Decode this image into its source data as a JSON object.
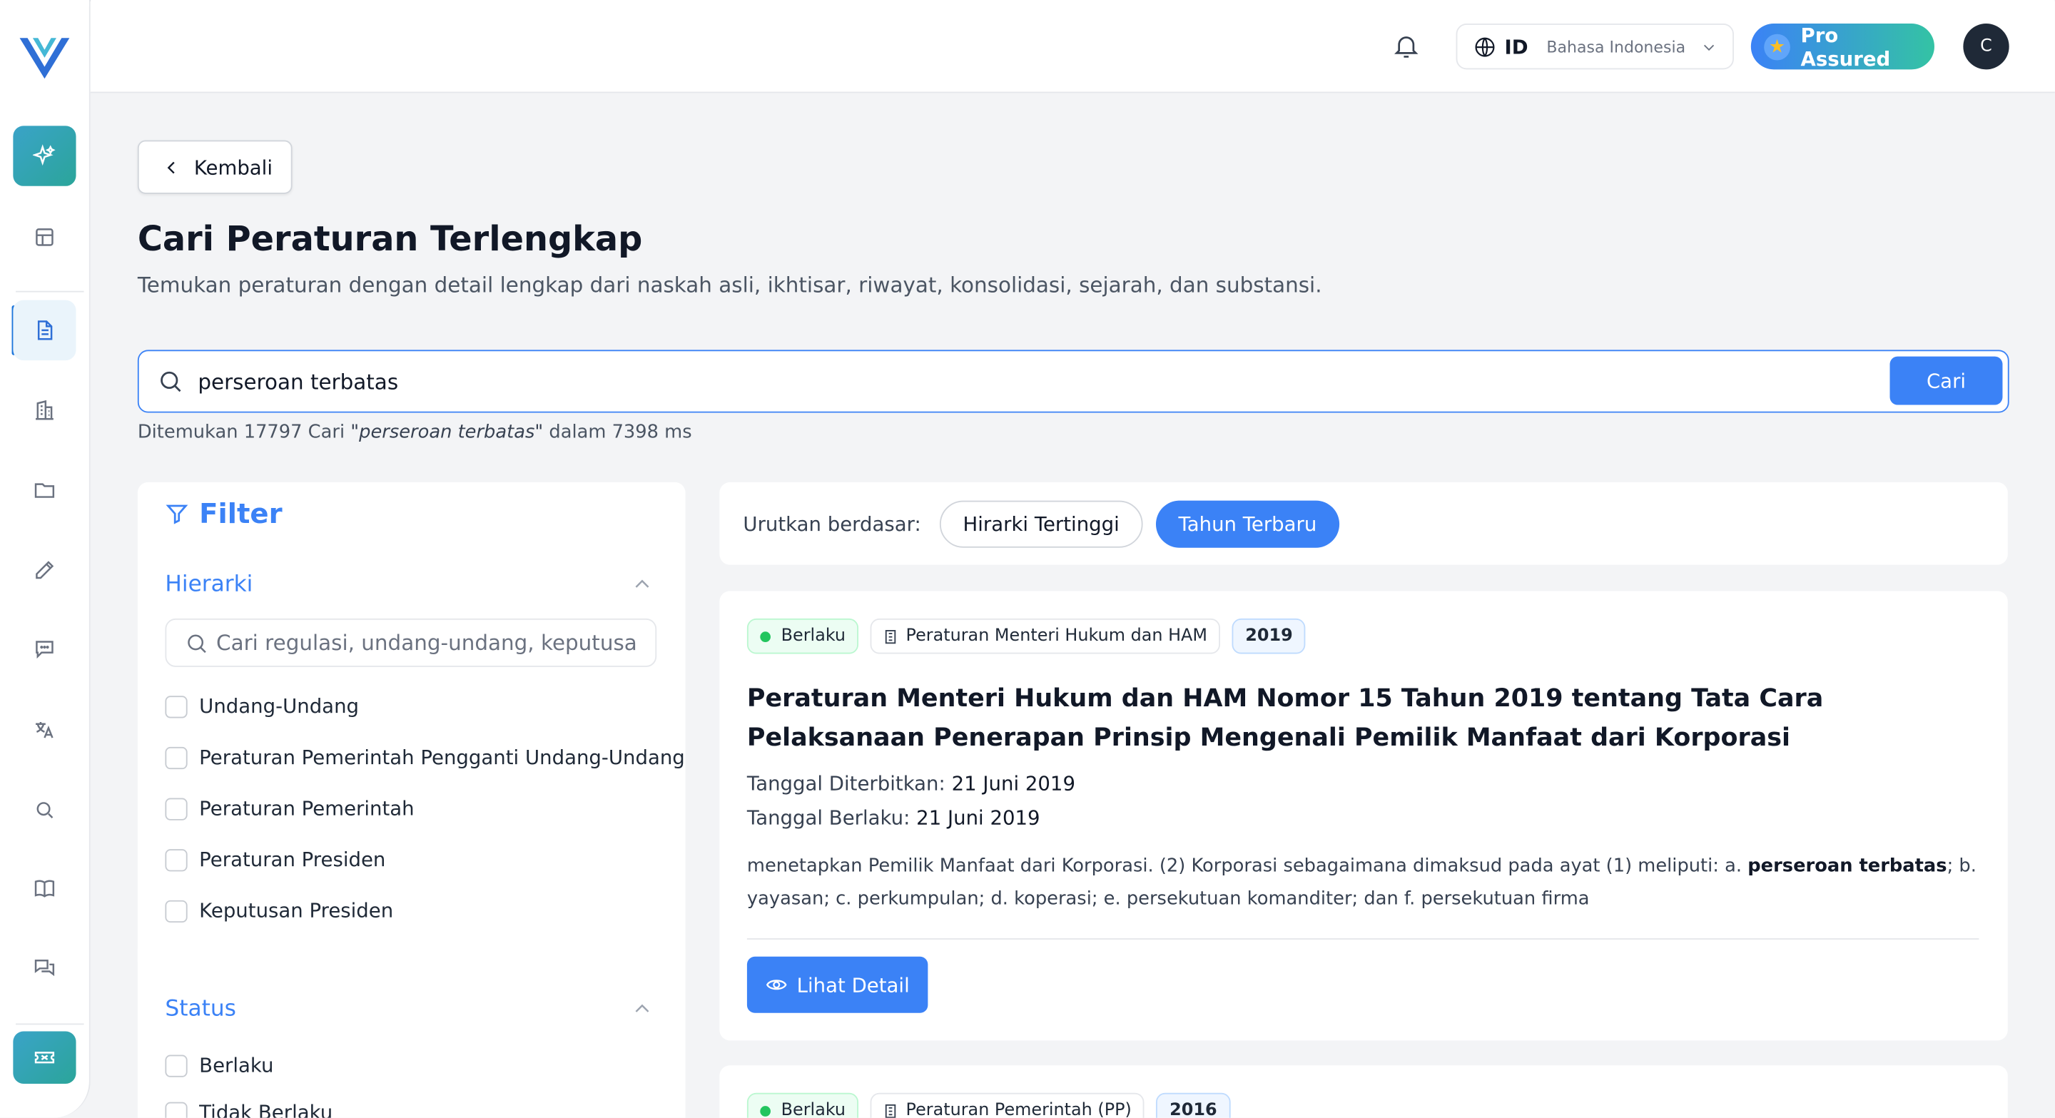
{
  "header": {
    "language_code": "ID",
    "language_name": "Bahasa Indonesia",
    "pro_label": "Pro Assured",
    "avatar_initial": "C"
  },
  "page": {
    "back_label": "Kembali",
    "title": "Cari Peraturan Terlengkap",
    "subtitle": "Temukan peraturan dengan detail lengkap dari naskah asli, ikhtisar, riwayat, konsolidasi, sejarah, dan substansi."
  },
  "search": {
    "value": "perseroan terbatas",
    "button": "Cari",
    "result_prefix": "Ditemukan 17797 Cari ",
    "result_query": "\"perseroan terbatas\"",
    "result_suffix": " dalam 7398 ms"
  },
  "filter": {
    "title": "Filter",
    "hierarchy_label": "Hierarki",
    "hierarchy_placeholder": "Cari regulasi, undang-undang, keputusan",
    "hierarchy_options": [
      "Undang-Undang",
      "Peraturan Pemerintah Pengganti Undang-Undang",
      "Peraturan Pemerintah",
      "Peraturan Presiden",
      "Keputusan Presiden"
    ],
    "status_label": "Status",
    "status_options": [
      "Berlaku",
      "Tidak Berlaku"
    ]
  },
  "sort": {
    "label": "Urutkan berdasar:",
    "options": [
      "Hirarki Tertinggi",
      "Tahun Terbaru"
    ],
    "selected": "Tahun Terbaru"
  },
  "results": [
    {
      "status": "Berlaku",
      "type": "Peraturan Menteri Hukum dan HAM",
      "year": "2019",
      "title": "Peraturan Menteri Hukum dan HAM Nomor 15 Tahun 2019 tentang Tata Cara Pelaksanaan Penerapan Prinsip Mengenali Pemilik Manfaat dari Korporasi",
      "published_label": "Tanggal Diterbitkan:",
      "published": "21 Juni 2019",
      "effective_label": "Tanggal Berlaku:",
      "effective": "21 Juni 2019",
      "snippet_before": "menetapkan Pemilik Manfaat dari Korporasi. (2) Korporasi sebagaimana dimaksud pada ayat (1) meliputi: a. ",
      "snippet_highlight": "perseroan terbatas",
      "snippet_after": "; b. yayasan; c. perkumpulan; d. koperasi; e. persekutuan komanditer; dan f. persekutuan firma",
      "detail_label": "Lihat Detail"
    },
    {
      "status": "Berlaku",
      "type": "Peraturan Pemerintah (PP)",
      "year": "2016"
    }
  ],
  "colors": {
    "primary": "#3b82f6",
    "sidebar_accent": "#2ba59a",
    "status_green": "#22c55e"
  },
  "icons": [
    "logo",
    "sparkle-icon",
    "table-icon",
    "document-icon",
    "building-icon",
    "folder-icon",
    "pencil-icon",
    "chat-icon",
    "translate-icon",
    "search-icon",
    "book-icon",
    "messages-icon",
    "ticket-icon",
    "bell-icon",
    "globe-icon",
    "filter-icon",
    "eye-icon"
  ]
}
